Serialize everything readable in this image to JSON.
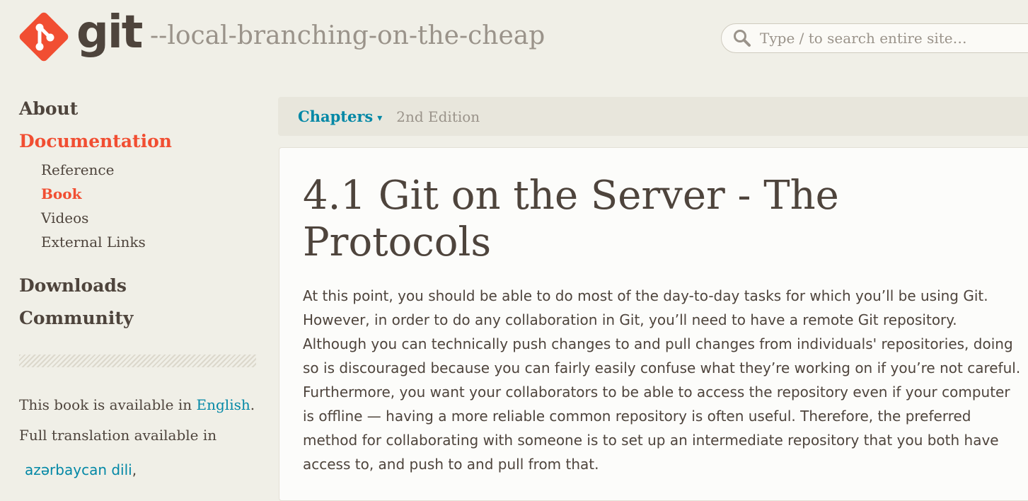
{
  "header": {
    "logo_text": "git",
    "tagline": "--local-branching-on-the-cheap",
    "search_placeholder": "Type / to search entire site…"
  },
  "sidebar": {
    "main_items": [
      {
        "label": "About"
      },
      {
        "label": "Documentation"
      },
      {
        "label": "Downloads"
      },
      {
        "label": "Community"
      }
    ],
    "doc_sub_items": [
      {
        "label": "Reference"
      },
      {
        "label": "Book"
      },
      {
        "label": "Videos"
      },
      {
        "label": "External Links"
      }
    ],
    "availability_prefix": "This book is available in ",
    "availability_link": "English",
    "availability_suffix": ".",
    "translation_text": "Full translation available in",
    "translation_first_language": "azərbaycan dili",
    "translation_separator": ","
  },
  "chapters_bar": {
    "label": "Chapters",
    "caret": "▾",
    "edition": "2nd Edition"
  },
  "content": {
    "title": "4.1 Git on the Server - The Protocols",
    "paragraph": "At this point, you should be able to do most of the day-to-day tasks for which you’ll be using Git. However, in order to do any collaboration in Git, you’ll need to have a remote Git repository. Although you can technically push changes to and pull changes from individuals' repositories, doing so is discouraged because you can fairly easily confuse what they’re working on if you’re not careful. Furthermore, you want your collaborators to be able to access the repository even if your computer is offline — having a more reliable common repository is often useful. Therefore, the preferred method for collaborating with someone is to set up an intermediate repository that you both have access to, and push to and pull from that."
  },
  "colors": {
    "accent": "#f14e32",
    "link": "#0388a6",
    "text": "#4e443c",
    "muted": "#9a938a",
    "background": "#f0efe7"
  }
}
